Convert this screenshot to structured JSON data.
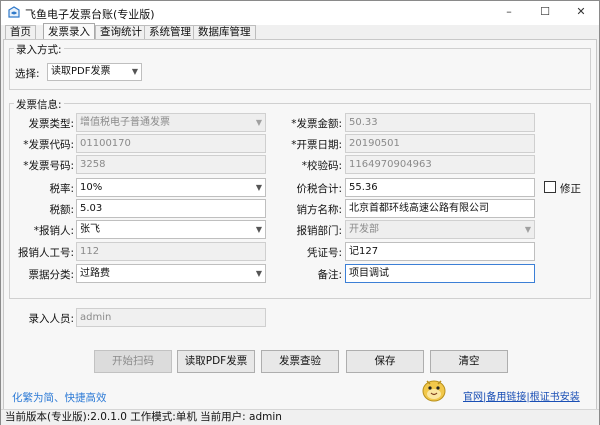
{
  "window": {
    "title": "飞鱼电子发票台账(专业版)",
    "minimize": "–",
    "maximize": "☐",
    "close": "✕"
  },
  "tabs": [
    {
      "label": "首页"
    },
    {
      "label": "发票录入"
    },
    {
      "label": "查询统计"
    },
    {
      "label": "系统管理"
    },
    {
      "label": "数据库管理"
    }
  ],
  "entry_mode": {
    "group_title": "录入方式:",
    "select_label": "选择:",
    "select_value": "读取PDF发票"
  },
  "invoice": {
    "group_title": "发票信息:",
    "type_label": "发票类型:",
    "type_value": "增值税电子普通发票",
    "code_label": "*发票代码:",
    "code_value": "01100170",
    "number_label": "*发票号码:",
    "number_value": "3258",
    "tax_rate_label": "税率:",
    "tax_rate_value": "10%",
    "tax_amount_label": "税额:",
    "tax_amount_value": "5.03",
    "reimburser_label": "*报销人:",
    "reimburser_value": "张飞",
    "reimburser_id_label": "报销人工号:",
    "reimburser_id_value": "112",
    "category_label": "票据分类:",
    "category_value": "过路费",
    "amount_label": "*发票金额:",
    "amount_value": "50.33",
    "date_label": "*开票日期:",
    "date_value": "20190501",
    "check_code_label": "*校验码:",
    "check_code_value": "1164970904963",
    "total_label": "价税合计:",
    "total_value": "55.36",
    "correct_label": "修正",
    "seller_label": "销方名称:",
    "seller_value": "北京首都环线高速公路有限公司",
    "department_label": "报销部门:",
    "department_value": "开发部",
    "voucher_label": "凭证号:",
    "voucher_value": "记127",
    "remark_label": "备注:",
    "remark_value": "项目调试"
  },
  "operator": {
    "label": "录入人员:",
    "value": "admin"
  },
  "buttons": {
    "scan": "开始扫码",
    "read_pdf": "读取PDF发票",
    "verify": "发票查验",
    "save": "保存",
    "clear": "清空"
  },
  "footer": {
    "slogan": "化繁为简、快捷高效",
    "help_link": "官网|备用链接|根证书安装",
    "status": "当前版本(专业版):2.0.1.0  工作模式:单机  当前用户: admin"
  },
  "colors": {
    "accent": "#3c7fd6",
    "slogan": "#2e7bd6",
    "link": "#1a4fb5"
  }
}
